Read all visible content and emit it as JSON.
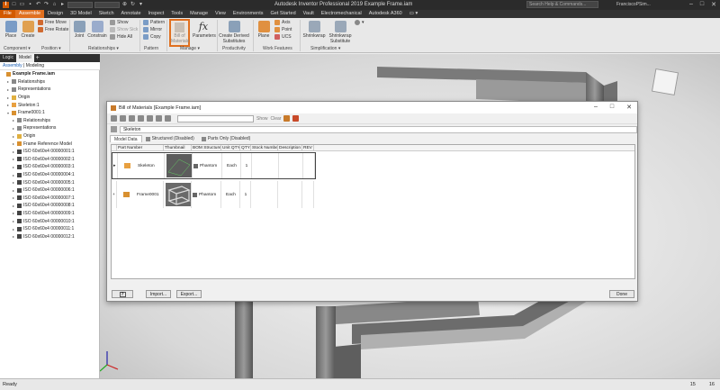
{
  "app": {
    "title": "Autodesk Inventor Professional 2019   Example Frame.iam",
    "search_placeholder": "Search Help & Commands...",
    "user": "FranciscoPSim...",
    "accent": "#e07020"
  },
  "menu": {
    "tabs": [
      "File",
      "Assemble",
      "Design",
      "3D Model",
      "Sketch",
      "Annotate",
      "Inspect",
      "Tools",
      "Manage",
      "View",
      "Environments",
      "Get Started",
      "Vault",
      "Electromechanical",
      "Autodesk A360"
    ],
    "active": "Assemble"
  },
  "ribbon": {
    "place": "Place",
    "create": "Create",
    "free_move": "Free Move",
    "free_rotate": "Free Rotate",
    "joint": "Joint",
    "constrain": "Constrain",
    "show": "Show",
    "show_sick": "Show Sick",
    "hide_all": "Hide All",
    "pattern": "Pattern",
    "mirror": "Mirror",
    "copy": "Copy",
    "bom_line1": "Bill of",
    "bom_line2": "Materials",
    "parameters": "Parameters",
    "create_derived_1": "Create Derived",
    "create_derived_2": "Substitutes",
    "plane": "Plane",
    "axis": "Axis",
    "point": "Point",
    "ucs": "UCS",
    "shrinkwrap": "Shrinkwrap",
    "shrinkwrap_sub_1": "Shrinkwrap",
    "shrinkwrap_sub_2": "Substitute",
    "groups": {
      "component": "Component ▾",
      "position": "Position ▾",
      "relationships": "Relationships ▾",
      "pattern": "Pattern",
      "manage": "Manage ▾",
      "productivity": "Productivity",
      "work_features": "Work Features",
      "simplification": "Simplification ▾"
    }
  },
  "browser": {
    "tabs": [
      "Logic",
      "Model"
    ],
    "active_tab": "Model",
    "plus": "+",
    "sub_active": "Assembly",
    "sub_sep": "|",
    "sub_other": "Modeling",
    "tree": [
      {
        "label": "Example Frame.iam",
        "level": 0,
        "exp": "",
        "bold": true
      },
      {
        "label": "Relationships",
        "level": 1,
        "exp": "▸"
      },
      {
        "label": "Representations",
        "level": 1,
        "exp": "▸"
      },
      {
        "label": "Origin",
        "level": 1,
        "exp": "▸"
      },
      {
        "label": "Skeleton:1",
        "level": 1,
        "exp": "▸"
      },
      {
        "label": "Frame0001:1",
        "level": 1,
        "exp": "▾"
      },
      {
        "label": "Relationships",
        "level": 2,
        "exp": "▸"
      },
      {
        "label": "Representations",
        "level": 2,
        "exp": "▸"
      },
      {
        "label": "Origin",
        "level": 2,
        "exp": "▸"
      },
      {
        "label": "Frame Reference Model",
        "level": 2,
        "exp": "▸"
      },
      {
        "label": "ISO 60x60x4 00000001:1",
        "level": 2,
        "exp": "▸"
      },
      {
        "label": "ISO 60x60x4 00000002:1",
        "level": 2,
        "exp": "▸"
      },
      {
        "label": "ISO 60x60x4 00000003:1",
        "level": 2,
        "exp": "▸"
      },
      {
        "label": "ISO 60x60x4 00000004:1",
        "level": 2,
        "exp": "▸"
      },
      {
        "label": "ISO 60x60x4 00000005:1",
        "level": 2,
        "exp": "▸"
      },
      {
        "label": "ISO 60x60x4 00000006:1",
        "level": 2,
        "exp": "▸"
      },
      {
        "label": "ISO 60x60x4 00000007:1",
        "level": 2,
        "exp": "▸"
      },
      {
        "label": "ISO 60x60x4 00000008:1",
        "level": 2,
        "exp": "▸"
      },
      {
        "label": "ISO 60x60x4 00000009:1",
        "level": 2,
        "exp": "▸"
      },
      {
        "label": "ISO 60x60x4 00000010:1",
        "level": 2,
        "exp": "▸"
      },
      {
        "label": "ISO 60x60x4 00000011:1",
        "level": 2,
        "exp": "▸"
      },
      {
        "label": "ISO 60x60x4 00000012:1",
        "level": 2,
        "exp": "▸"
      }
    ]
  },
  "viewcube_label": "FRONT",
  "dialog": {
    "title": "Bill of Materials [Example Frame.iam]",
    "toolbar_show": "Show",
    "toolbar_clear": "Clear",
    "path": "Skeleton",
    "tabs": [
      "Model Data",
      "Structured (Disabled)",
      "Parts Only (Disabled)"
    ],
    "columns": [
      "Part Number",
      "Thumbnail",
      "BOM Structure",
      "Unit QTY",
      "QTY",
      "Stock Number",
      "Description",
      "REV"
    ],
    "rows": [
      {
        "expander": "▸",
        "part": "Skeleton",
        "bom": "Phantom",
        "unit": "Each",
        "qty": "1"
      },
      {
        "expander": "+",
        "part": "Frame0001",
        "bom": "Phantom",
        "unit": "Each",
        "qty": "1"
      }
    ],
    "help_icon": "?",
    "import": "Import...",
    "export": "Export...",
    "done": "Done"
  },
  "status": {
    "text": "Ready",
    "num1": "15",
    "num2": "16"
  }
}
